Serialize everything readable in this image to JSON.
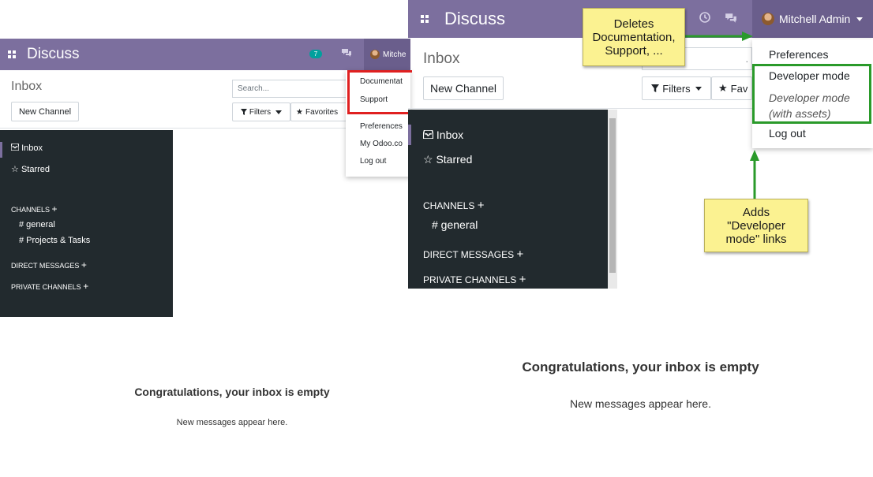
{
  "colors": {
    "navbar": "#7c6f9e",
    "sidebar": "#222a2e",
    "annotation_red": "#e02020",
    "annotation_green": "#2a9a2a",
    "note_yellow": "#fbf291"
  },
  "left": {
    "app_title": "Discuss",
    "user_name": "Mitche",
    "badge_count": "7",
    "breadcrumb": "Inbox",
    "new_channel": "New Channel",
    "search_placeholder": "Search...",
    "filters": "Filters",
    "favorites": "Favorites",
    "menu": [
      "Documentat",
      "Support",
      "Preferences",
      "My Odoo.co",
      "Log out"
    ],
    "sidebar": {
      "inbox": "Inbox",
      "starred": "Starred",
      "channels": "CHANNELS",
      "channel_items": [
        "# general",
        "# Projects & Tasks"
      ],
      "direct_messages": "DIRECT MESSAGES",
      "private_channels": "PRIVATE CHANNELS"
    },
    "empty_title": "Congratulations, your inbox is empty",
    "empty_sub": "New messages appear here."
  },
  "right": {
    "app_title": "Discuss",
    "user_name": "Mitchell Admin",
    "breadcrumb": "Inbox",
    "new_channel": "New Channel",
    "filters": "Filters",
    "favorites": "Fav",
    "search_fragment": ".",
    "menu": {
      "preferences": "Preferences",
      "developer_mode": "Developer mode",
      "developer_mode_assets_1": "Developer mode",
      "developer_mode_assets_2": "(with assets)",
      "log_out": "Log out"
    },
    "sidebar": {
      "inbox": "Inbox",
      "starred": "Starred",
      "channels": "CHANNELS",
      "channel_items": [
        "# general"
      ],
      "direct_messages": "DIRECT MESSAGES",
      "private_channels": "PRIVATE CHANNELS"
    },
    "empty_title": "Congratulations, your inbox is empty",
    "empty_sub": "New messages appear here."
  },
  "notes": {
    "deletes_lines": [
      "Deletes",
      "Documentation,",
      "Support, ..."
    ],
    "adds_lines": [
      "Adds",
      "\"Developer",
      "mode\" links"
    ]
  },
  "icons": {
    "apps": "apps-grid-icon",
    "activity": "clock-icon",
    "chat": "chat-bubbles-icon",
    "inbox": "inbox-tray-icon",
    "starred": "star-outline-icon",
    "filter": "funnel-icon",
    "favorite": "star-filled-icon",
    "add": "plus-icon",
    "dropdown": "caret-down-icon"
  }
}
